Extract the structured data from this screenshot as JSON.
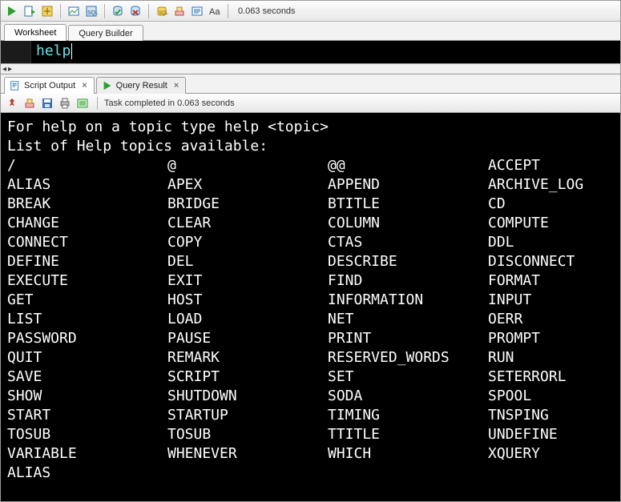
{
  "toolbar": {
    "elapsed": "0.063 seconds"
  },
  "worksheet_tabs": {
    "worksheet": "Worksheet",
    "query_builder": "Query Builder"
  },
  "editor": {
    "content": "help"
  },
  "result_tabs": {
    "script_output": "Script Output",
    "query_result": "Query Result"
  },
  "task_status": "Task completed in 0.063 seconds",
  "output": {
    "line1": "For help on a topic type help <topic>",
    "line2": "List of Help topics available:",
    "topics": [
      "/",
      "@",
      "@@",
      "ACCEPT",
      "ALIAS",
      "APEX",
      "APPEND",
      "ARCHIVE_LOG",
      "BREAK",
      "BRIDGE",
      "BTITLE",
      "CD",
      "CHANGE",
      "CLEAR",
      "COLUMN",
      "COMPUTE",
      "CONNECT",
      "COPY",
      "CTAS",
      "DDL",
      "DEFINE",
      "DEL",
      "DESCRIBE",
      "DISCONNECT",
      "EXECUTE",
      "EXIT",
      "FIND",
      "FORMAT",
      "GET",
      "HOST",
      "INFORMATION",
      "INPUT",
      "LIST",
      "LOAD",
      "NET",
      "OERR",
      "PASSWORD",
      "PAUSE",
      "PRINT",
      "PROMPT",
      "QUIT",
      "REMARK",
      "RESERVED_WORDS",
      "RUN",
      "SAVE",
      "SCRIPT",
      "SET",
      "SETERRORL",
      "SHOW",
      "SHUTDOWN",
      "SODA",
      "SPOOL",
      "START",
      "STARTUP",
      "TIMING",
      "TNSPING",
      "TOSUB",
      "TOSUB",
      "TTITLE",
      "UNDEFINE",
      "VARIABLE",
      "WHENEVER",
      "WHICH",
      "XQUERY",
      "ALIAS"
    ]
  }
}
